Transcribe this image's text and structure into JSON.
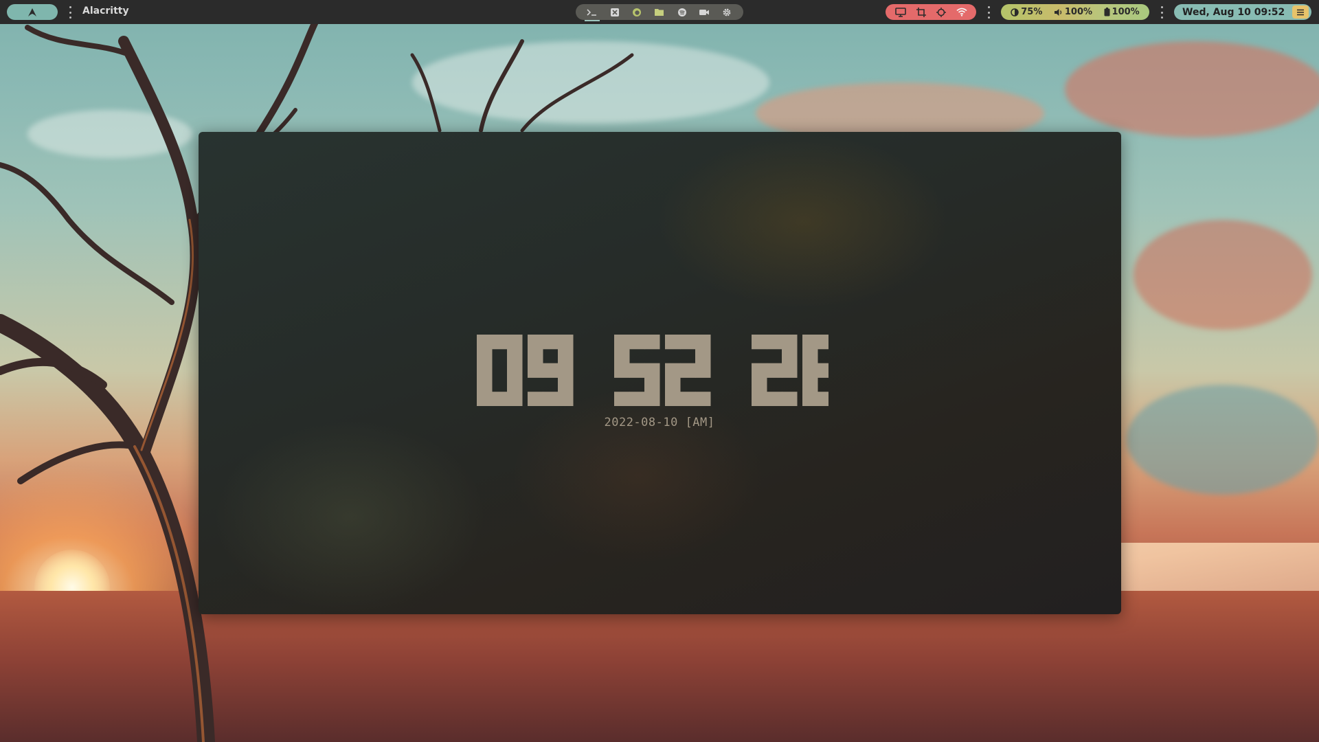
{
  "topbar": {
    "launcher_icon": "arch-logo-icon",
    "window_title": "Alacritty",
    "dock": [
      {
        "icon": "terminal-icon",
        "active": true
      },
      {
        "icon": "code-editor-icon",
        "active": false
      },
      {
        "icon": "firefox-icon",
        "active": false
      },
      {
        "icon": "folder-icon",
        "active": false
      },
      {
        "icon": "spotify-icon",
        "active": false
      },
      {
        "icon": "video-camera-icon",
        "active": false
      },
      {
        "icon": "settings-gear-icon",
        "active": false
      }
    ],
    "tray": [
      {
        "icon": "monitor-icon"
      },
      {
        "icon": "crop-icon"
      },
      {
        "icon": "target-icon"
      },
      {
        "icon": "wifi-icon"
      }
    ],
    "stats": {
      "brightness_label": "75%",
      "volume_label": "100%",
      "battery_label": "100%"
    },
    "clock": "Wed, Aug 10 09:52",
    "menu_icon": "hamburger-menu-icon",
    "colors": {
      "bar_bg": "#2b2b2b",
      "launcher_pill": "#7fb6ad",
      "dock_pill": "#5a5a55",
      "tray_pill": "#e46a6a",
      "stats_pill": "#b9c46c",
      "clock_pill": "#88bcb3",
      "menu_button": "#e7c36a"
    }
  },
  "terminal": {
    "time_hours": "09",
    "time_minutes": "52",
    "time_seconds": "28",
    "date_line": "2022-08-10 [AM]",
    "digit_color": "#a39886"
  }
}
